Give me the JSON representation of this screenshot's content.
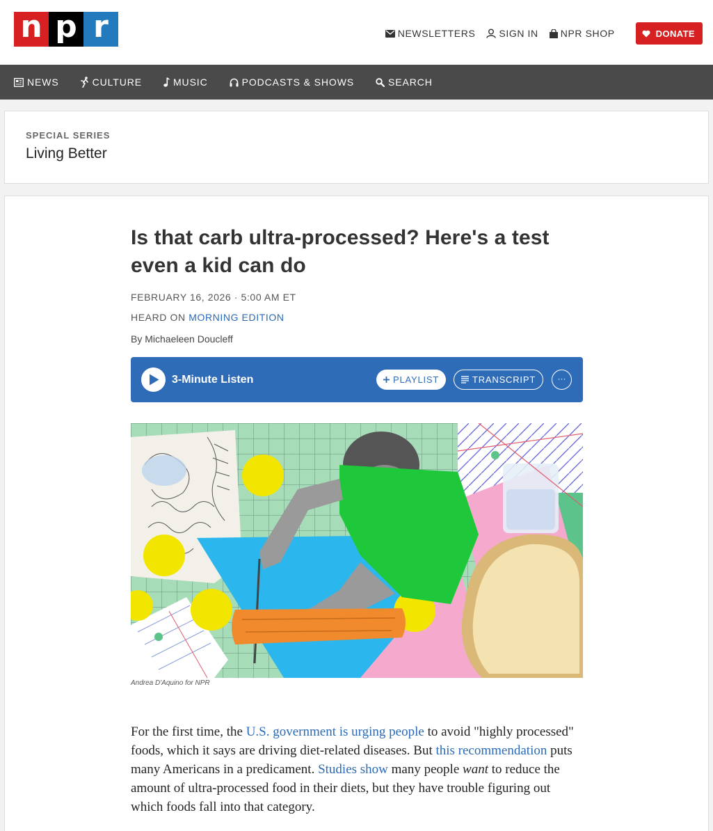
{
  "header": {
    "logo_letters": [
      "n",
      "p",
      "r"
    ],
    "links": {
      "newsletters": "NEWSLETTERS",
      "sign_in": "SIGN IN",
      "shop": "NPR SHOP",
      "donate": "DONATE"
    }
  },
  "nav": {
    "news": "NEWS",
    "culture": "CULTURE",
    "music": "MUSIC",
    "podcasts": "PODCASTS & SHOWS",
    "search": "SEARCH"
  },
  "series": {
    "label": "SPECIAL SERIES",
    "title": "Living Better"
  },
  "article": {
    "headline": "Is that carb ultra-processed? Here's a test even a kid can do",
    "dateline": "FEBRUARY 16, 2026 · 5:00 AM ET",
    "heard_on_prefix": "HEARD ON",
    "heard_on_show": "MORNING EDITION",
    "byline": "By Michaeleen Doucleff",
    "player": {
      "listen_label": "3-Minute Listen",
      "playlist_label": "PLAYLIST",
      "transcript_label": "TRANSCRIPT",
      "more_label": "···"
    },
    "image_credit": "Andrea D'Aquino for NPR",
    "body": {
      "p1_a": "For the first time, the ",
      "p1_link1": "U.S. government is urging people",
      "p1_b": " to avoid \"highly processed\" foods, which it says are driving diet-related diseases. But ",
      "p1_link2": "this recommendation",
      "p1_c": " puts many Americans in a predicament. ",
      "p1_link3": "Studies show",
      "p1_d": " many people ",
      "p1_em": "want",
      "p1_e": " to reduce the amount of ultra-processed food in their diets, but they have trouble figuring out which foods fall into that category."
    }
  },
  "colors": {
    "npr_red": "#d62021",
    "npr_blue": "#237bbd",
    "nav_bg": "#4a4a4a",
    "player_bg": "#2f6cb8",
    "link": "#2a6ab5"
  }
}
